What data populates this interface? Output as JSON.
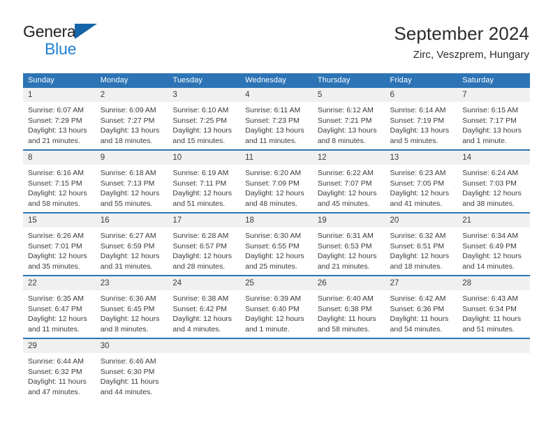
{
  "brand": {
    "line1": "General",
    "line2": "Blue",
    "triangle_color": "#1565a8",
    "blue_text_color": "#1e7fd4"
  },
  "header": {
    "title": "September 2024",
    "location": "Zirc, Veszprem, Hungary"
  },
  "theme": {
    "header_blue": "#2c74b5",
    "daynum_background": "#f0f0f0",
    "text": "#3a3a3a"
  },
  "weekdays": [
    "Sunday",
    "Monday",
    "Tuesday",
    "Wednesday",
    "Thursday",
    "Friday",
    "Saturday"
  ],
  "weeks": [
    [
      {
        "day": "1",
        "sunrise": "Sunrise: 6:07 AM",
        "sunset": "Sunset: 7:29 PM",
        "daylight": "Daylight: 13 hours and 21 minutes."
      },
      {
        "day": "2",
        "sunrise": "Sunrise: 6:09 AM",
        "sunset": "Sunset: 7:27 PM",
        "daylight": "Daylight: 13 hours and 18 minutes."
      },
      {
        "day": "3",
        "sunrise": "Sunrise: 6:10 AM",
        "sunset": "Sunset: 7:25 PM",
        "daylight": "Daylight: 13 hours and 15 minutes."
      },
      {
        "day": "4",
        "sunrise": "Sunrise: 6:11 AM",
        "sunset": "Sunset: 7:23 PM",
        "daylight": "Daylight: 13 hours and 11 minutes."
      },
      {
        "day": "5",
        "sunrise": "Sunrise: 6:12 AM",
        "sunset": "Sunset: 7:21 PM",
        "daylight": "Daylight: 13 hours and 8 minutes."
      },
      {
        "day": "6",
        "sunrise": "Sunrise: 6:14 AM",
        "sunset": "Sunset: 7:19 PM",
        "daylight": "Daylight: 13 hours and 5 minutes."
      },
      {
        "day": "7",
        "sunrise": "Sunrise: 6:15 AM",
        "sunset": "Sunset: 7:17 PM",
        "daylight": "Daylight: 13 hours and 1 minute."
      }
    ],
    [
      {
        "day": "8",
        "sunrise": "Sunrise: 6:16 AM",
        "sunset": "Sunset: 7:15 PM",
        "daylight": "Daylight: 12 hours and 58 minutes."
      },
      {
        "day": "9",
        "sunrise": "Sunrise: 6:18 AM",
        "sunset": "Sunset: 7:13 PM",
        "daylight": "Daylight: 12 hours and 55 minutes."
      },
      {
        "day": "10",
        "sunrise": "Sunrise: 6:19 AM",
        "sunset": "Sunset: 7:11 PM",
        "daylight": "Daylight: 12 hours and 51 minutes."
      },
      {
        "day": "11",
        "sunrise": "Sunrise: 6:20 AM",
        "sunset": "Sunset: 7:09 PM",
        "daylight": "Daylight: 12 hours and 48 minutes."
      },
      {
        "day": "12",
        "sunrise": "Sunrise: 6:22 AM",
        "sunset": "Sunset: 7:07 PM",
        "daylight": "Daylight: 12 hours and 45 minutes."
      },
      {
        "day": "13",
        "sunrise": "Sunrise: 6:23 AM",
        "sunset": "Sunset: 7:05 PM",
        "daylight": "Daylight: 12 hours and 41 minutes."
      },
      {
        "day": "14",
        "sunrise": "Sunrise: 6:24 AM",
        "sunset": "Sunset: 7:03 PM",
        "daylight": "Daylight: 12 hours and 38 minutes."
      }
    ],
    [
      {
        "day": "15",
        "sunrise": "Sunrise: 6:26 AM",
        "sunset": "Sunset: 7:01 PM",
        "daylight": "Daylight: 12 hours and 35 minutes."
      },
      {
        "day": "16",
        "sunrise": "Sunrise: 6:27 AM",
        "sunset": "Sunset: 6:59 PM",
        "daylight": "Daylight: 12 hours and 31 minutes."
      },
      {
        "day": "17",
        "sunrise": "Sunrise: 6:28 AM",
        "sunset": "Sunset: 6:57 PM",
        "daylight": "Daylight: 12 hours and 28 minutes."
      },
      {
        "day": "18",
        "sunrise": "Sunrise: 6:30 AM",
        "sunset": "Sunset: 6:55 PM",
        "daylight": "Daylight: 12 hours and 25 minutes."
      },
      {
        "day": "19",
        "sunrise": "Sunrise: 6:31 AM",
        "sunset": "Sunset: 6:53 PM",
        "daylight": "Daylight: 12 hours and 21 minutes."
      },
      {
        "day": "20",
        "sunrise": "Sunrise: 6:32 AM",
        "sunset": "Sunset: 6:51 PM",
        "daylight": "Daylight: 12 hours and 18 minutes."
      },
      {
        "day": "21",
        "sunrise": "Sunrise: 6:34 AM",
        "sunset": "Sunset: 6:49 PM",
        "daylight": "Daylight: 12 hours and 14 minutes."
      }
    ],
    [
      {
        "day": "22",
        "sunrise": "Sunrise: 6:35 AM",
        "sunset": "Sunset: 6:47 PM",
        "daylight": "Daylight: 12 hours and 11 minutes."
      },
      {
        "day": "23",
        "sunrise": "Sunrise: 6:36 AM",
        "sunset": "Sunset: 6:45 PM",
        "daylight": "Daylight: 12 hours and 8 minutes."
      },
      {
        "day": "24",
        "sunrise": "Sunrise: 6:38 AM",
        "sunset": "Sunset: 6:42 PM",
        "daylight": "Daylight: 12 hours and 4 minutes."
      },
      {
        "day": "25",
        "sunrise": "Sunrise: 6:39 AM",
        "sunset": "Sunset: 6:40 PM",
        "daylight": "Daylight: 12 hours and 1 minute."
      },
      {
        "day": "26",
        "sunrise": "Sunrise: 6:40 AM",
        "sunset": "Sunset: 6:38 PM",
        "daylight": "Daylight: 11 hours and 58 minutes."
      },
      {
        "day": "27",
        "sunrise": "Sunrise: 6:42 AM",
        "sunset": "Sunset: 6:36 PM",
        "daylight": "Daylight: 11 hours and 54 minutes."
      },
      {
        "day": "28",
        "sunrise": "Sunrise: 6:43 AM",
        "sunset": "Sunset: 6:34 PM",
        "daylight": "Daylight: 11 hours and 51 minutes."
      }
    ],
    [
      {
        "day": "29",
        "sunrise": "Sunrise: 6:44 AM",
        "sunset": "Sunset: 6:32 PM",
        "daylight": "Daylight: 11 hours and 47 minutes."
      },
      {
        "day": "30",
        "sunrise": "Sunrise: 6:46 AM",
        "sunset": "Sunset: 6:30 PM",
        "daylight": "Daylight: 11 hours and 44 minutes."
      },
      {
        "day": "",
        "sunrise": "",
        "sunset": "",
        "daylight": ""
      },
      {
        "day": "",
        "sunrise": "",
        "sunset": "",
        "daylight": ""
      },
      {
        "day": "",
        "sunrise": "",
        "sunset": "",
        "daylight": ""
      },
      {
        "day": "",
        "sunrise": "",
        "sunset": "",
        "daylight": ""
      },
      {
        "day": "",
        "sunrise": "",
        "sunset": "",
        "daylight": ""
      }
    ]
  ]
}
